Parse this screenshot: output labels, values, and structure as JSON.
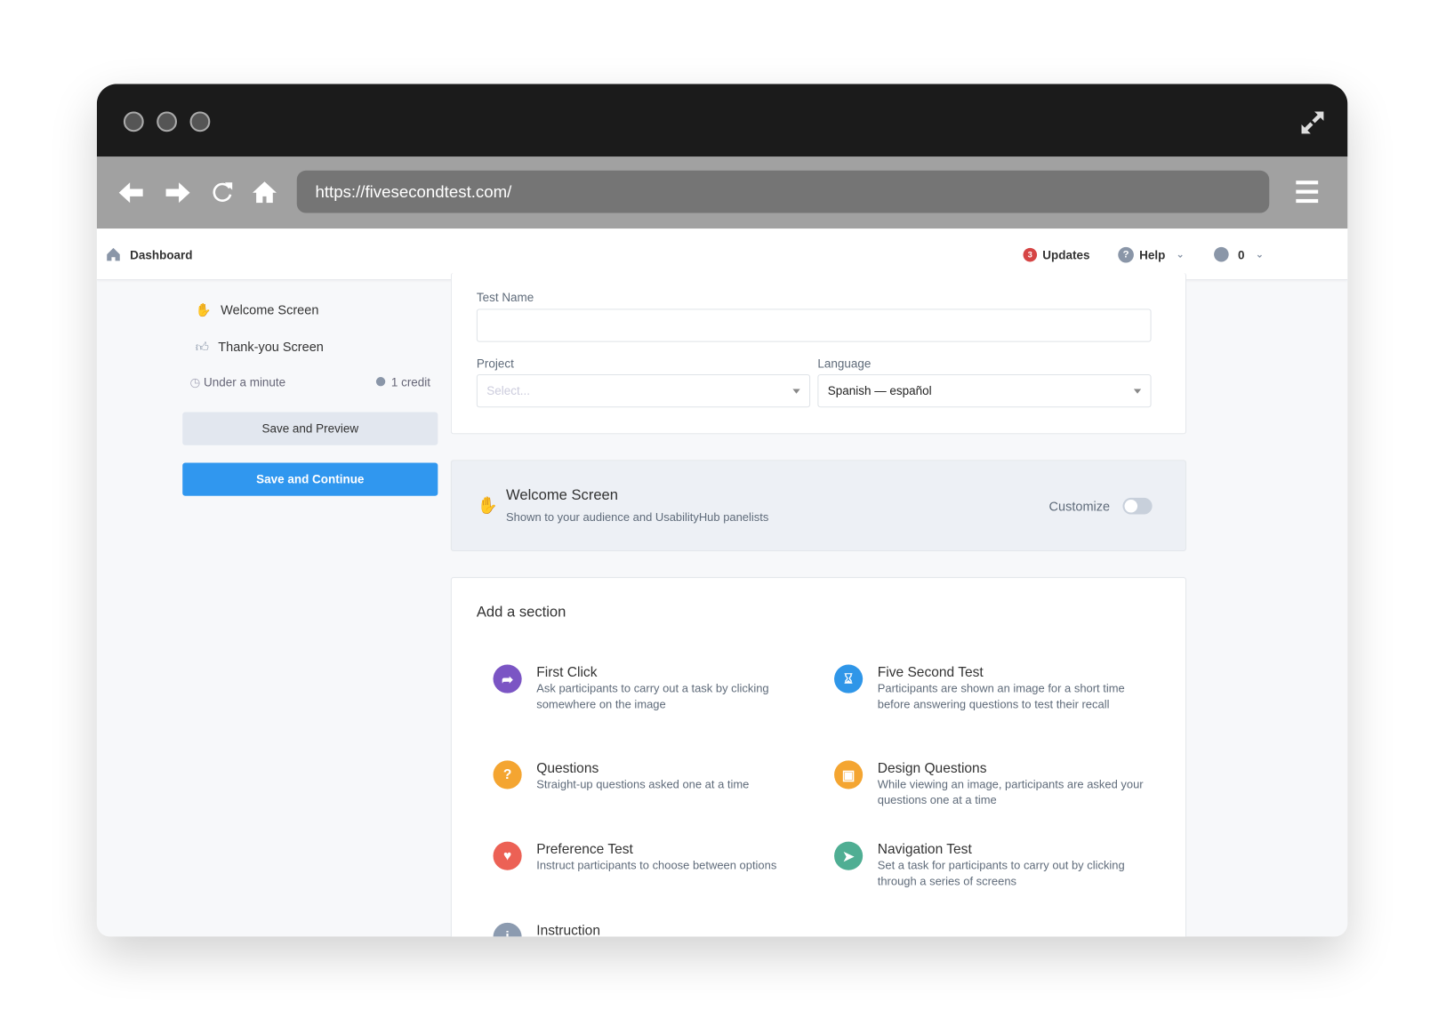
{
  "browser": {
    "url": "https://fivesecondtest.com/"
  },
  "header": {
    "dashboard": "Dashboard",
    "updates": "Updates",
    "updates_count": "3",
    "help": "Help",
    "credits": "0"
  },
  "sidebar": {
    "items": [
      {
        "label": "Welcome Screen",
        "icon": "wave-hand-icon"
      },
      {
        "label": "Thank-you Screen",
        "icon": "thumbs-up-icon"
      }
    ],
    "duration": "Under a minute",
    "cost": "1 credit",
    "save_preview": "Save and Preview",
    "save_continue": "Save and Continue"
  },
  "form": {
    "test_name_label": "Test Name",
    "test_name_value": "",
    "project_label": "Project",
    "project_placeholder": "Select...",
    "language_label": "Language",
    "language_value": "Spanish — español"
  },
  "welcome": {
    "title": "Welcome Screen",
    "subtitle": "Shown to your audience and UsabilityHub panelists",
    "customize": "Customize",
    "customize_on": false
  },
  "add_section": {
    "title": "Add a section",
    "items": [
      {
        "title": "First Click",
        "desc": "Ask participants to carry out a task by clicking somewhere on the image",
        "color": "#7b55c4",
        "icon": "cursor-icon"
      },
      {
        "title": "Five Second Test",
        "desc": "Participants are shown an image for a short time before answering questions to test their recall",
        "color": "#2f96e8",
        "icon": "hourglass-icon"
      },
      {
        "title": "Questions",
        "desc": "Straight-up questions asked one at a time",
        "color": "#f4a531",
        "icon": "question-icon"
      },
      {
        "title": "Design Questions",
        "desc": "While viewing an image, participants are asked your questions one at a time",
        "color": "#f4a531",
        "icon": "image-icon"
      },
      {
        "title": "Preference Test",
        "desc": "Instruct participants to choose between options",
        "color": "#ec6155",
        "icon": "heart-icon"
      },
      {
        "title": "Navigation Test",
        "desc": "Set a task for participants to carry out by clicking through a series of screens",
        "color": "#4fae93",
        "icon": "navigation-arrow-icon"
      },
      {
        "title": "Instruction",
        "desc": "",
        "color": "#8c9bb0",
        "icon": "info-icon"
      }
    ]
  },
  "colors": {
    "primary": "#3097ef",
    "secondary_button": "#e2e7ef"
  }
}
